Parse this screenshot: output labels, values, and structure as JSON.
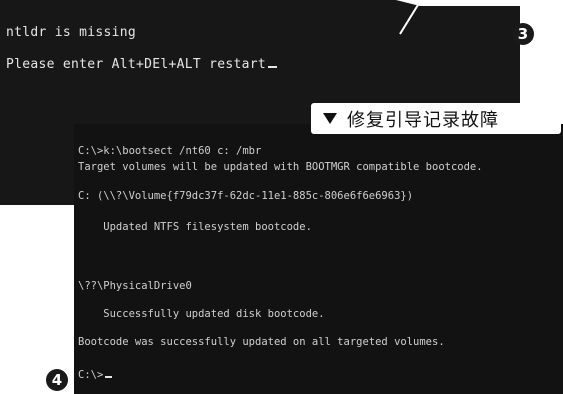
{
  "top_terminal": {
    "lines": [
      "ntldr is missing",
      "Please enter Alt+DEl+ALT restart"
    ]
  },
  "bottom_terminal": {
    "lines": [
      "C:\\>k:\\bootsect /nt60 c: /mbr",
      "Target volumes will be updated with BOOTMGR compatible bootcode.",
      "C: (\\\\?\\Volume{f79dc37f-62dc-11e1-885c-806e6f6e6963})",
      "    Updated NTFS filesystem bootcode.",
      "\\??\\PhysicalDrive0",
      "    Successfully updated disk bootcode.",
      "Bootcode was successfully updated on all targeted volumes.",
      "C:\\>"
    ]
  },
  "labels": {
    "step3": "3",
    "step4": "4",
    "caption": "修复引导记录故障"
  }
}
